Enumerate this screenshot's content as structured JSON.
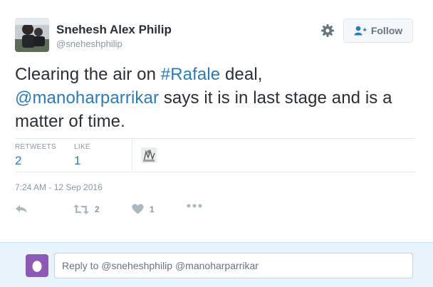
{
  "colors": {
    "link": "#2b7bb9",
    "muted": "#8899a6",
    "text": "#292f33",
    "reply_bg": "#e8f3fb",
    "egg": "#8c5ab6"
  },
  "author": {
    "name": "Snehesh Alex Philip",
    "handle": "@sneheshphilip",
    "avatar_icon": "profile-photo"
  },
  "header": {
    "settings_icon": "gear-icon",
    "follow_icon": "add-user-icon",
    "follow_label": "Follow"
  },
  "tweet": {
    "text_part1": "Clearing the air on ",
    "hashtag": "#Rafale",
    "text_part2": " deal,",
    "mention": "@manoharparrikar",
    "text_part3": " says it is in last stage and is a matter of time."
  },
  "stats": {
    "retweets_label": "RETWEETS",
    "retweets_count": "2",
    "likes_label": "LIKE",
    "likes_count": "1"
  },
  "timestamp": "7:24 AM - 12 Sep 2016",
  "actions": {
    "reply_icon": "reply-icon",
    "retweet_icon": "retweet-icon",
    "retweet_count": "2",
    "like_icon": "heart-icon",
    "like_count": "1",
    "more_icon": "more-icon"
  },
  "reply": {
    "avatar_icon": "egg-avatar",
    "placeholder": "Reply to @sneheshphilip @manoharparrikar"
  }
}
